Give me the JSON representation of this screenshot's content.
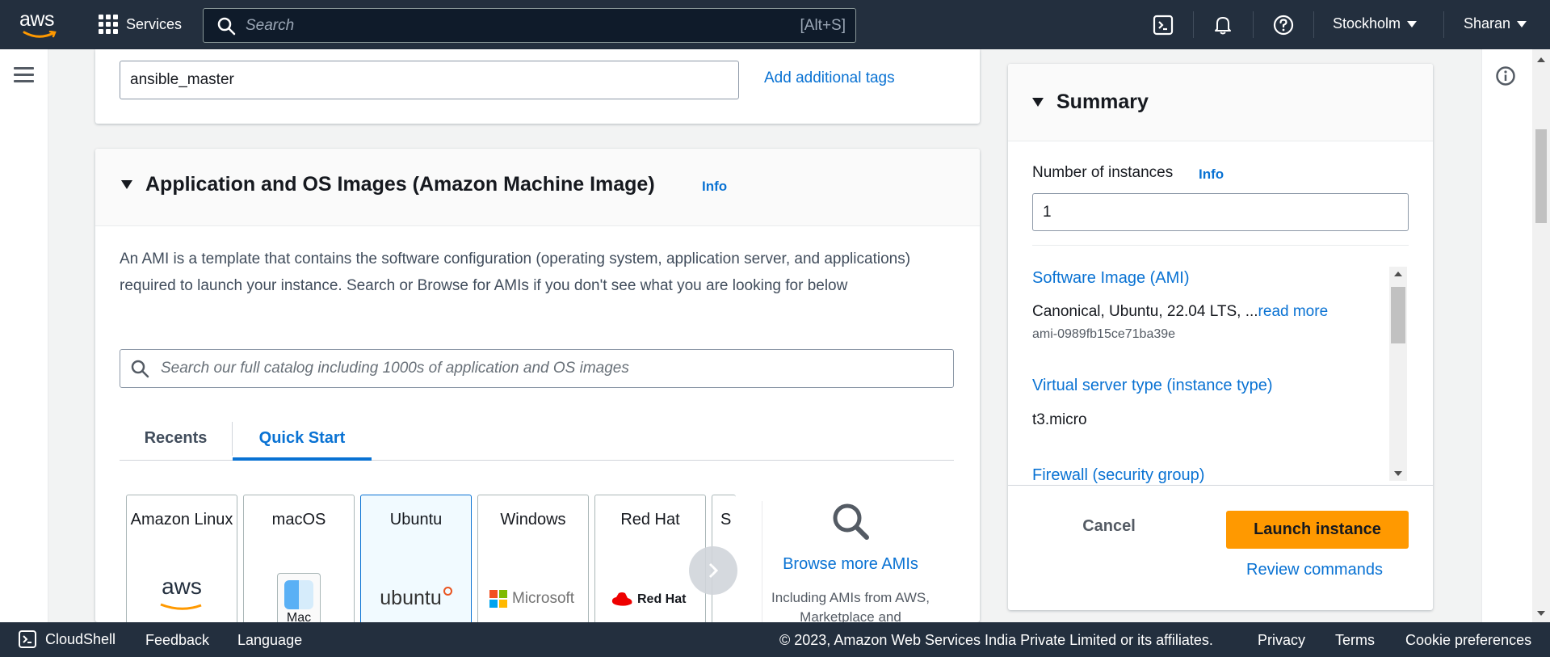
{
  "topnav": {
    "logo_text": "aws",
    "services_label": "Services",
    "search_placeholder": "Search",
    "search_shortcut": "[Alt+S]",
    "region_label": "Stockholm",
    "user_label": "Sharan"
  },
  "tags": {
    "name_value": "ansible_master",
    "add_tags_link": "Add additional tags"
  },
  "ami": {
    "title": "Application and OS Images (Amazon Machine Image)",
    "info_link": "Info",
    "description": "An AMI is a template that contains the software configuration (operating system, application server, and applications) required to launch your instance. Search or Browse for AMIs if you don't see what you are looking for below",
    "search_placeholder": "Search our full catalog including 1000s of application and OS images",
    "tabs": [
      {
        "label": "Recents"
      },
      {
        "label": "Quick Start"
      }
    ],
    "os_cards": [
      {
        "label": "Amazon Linux",
        "logo": "aws"
      },
      {
        "label": "macOS",
        "logo": "Mac"
      },
      {
        "label": "Ubuntu",
        "logo": "ubuntu"
      },
      {
        "label": "Windows",
        "logo": "Microsoft"
      },
      {
        "label": "Red Hat",
        "logo": "Red Hat"
      },
      {
        "label": "S",
        "logo": ""
      }
    ],
    "browse_link": "Browse more AMIs",
    "browse_sub": "Including AMIs from AWS, Marketplace and"
  },
  "summary": {
    "title": "Summary",
    "instances_label": "Number of instances",
    "instances_info": "Info",
    "instances_value": "1",
    "software_image_link": "Software Image (AMI)",
    "software_image_value": "Canonical, Ubuntu, 22.04 LTS, ...",
    "read_more": "read more",
    "ami_id": "ami-0989fb15ce71ba39e",
    "instance_type_link": "Virtual server type (instance type)",
    "instance_type_value": "t3.micro",
    "firewall_link": "Firewall (security group)",
    "cancel_label": "Cancel",
    "launch_label": "Launch instance",
    "review_label": "Review commands"
  },
  "footer": {
    "cloudshell": "CloudShell",
    "feedback": "Feedback",
    "language": "Language",
    "copyright": "© 2023, Amazon Web Services India Private Limited or its affiliates.",
    "privacy": "Privacy",
    "terms": "Terms",
    "cookies": "Cookie preferences"
  },
  "colors": {
    "nav_bg": "#232f3e",
    "link": "#0972d3",
    "primary_button": "#ff9900"
  }
}
